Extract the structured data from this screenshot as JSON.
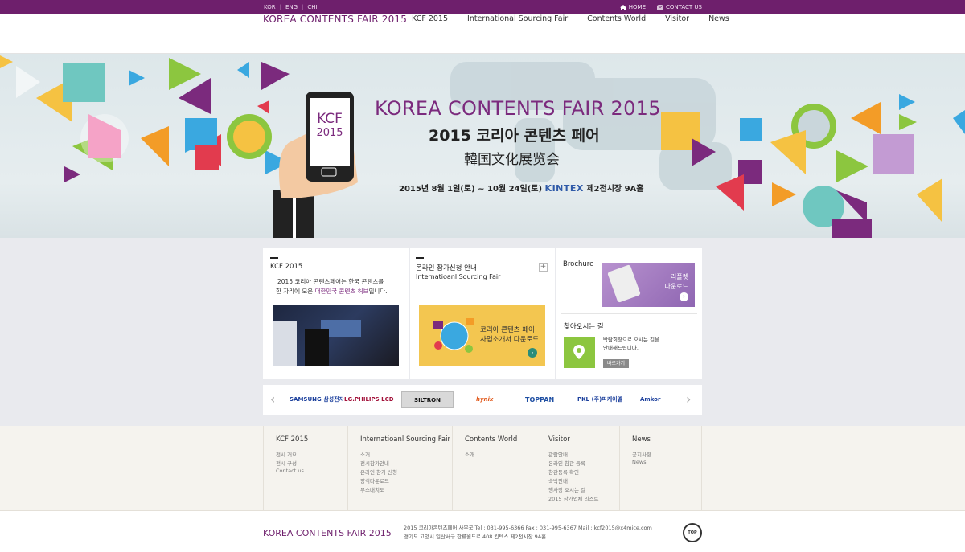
{
  "topbar": {
    "langs": [
      "KOR",
      "ENG",
      "CHI"
    ],
    "home": "HOME",
    "contact": "CONTACT US"
  },
  "header": {
    "logo": "KOREA CONTENTS FAIR 2015",
    "nav": [
      "KCF 2015",
      "International Sourcing Fair",
      "Contents World",
      "Visitor",
      "News"
    ]
  },
  "banner": {
    "title": "KOREA CONTENTS FAIR 2015",
    "title_ko": "2015 코리아 콘텐츠 페어",
    "title_cn": "韓国文化展览会",
    "phone_text": "KCF",
    "phone_year": "2015",
    "date": "2015년 8월 1일(토) ~ 10월 24일(토)",
    "venue_brand": "KINTEX",
    "venue": "제2전시장 9A홀"
  },
  "kcf_box": {
    "title": "KCF 2015",
    "line1": "2015 코리아 콘텐츠페어는 한국 콘텐츠를",
    "line2a": "한 자리에 모은 ",
    "line2b": "대한민국 콘텐츠 허브",
    "line2c": "입니다."
  },
  "sourcing_box": {
    "title1": "온라인 참가신청 안내",
    "title2": "Internatioanl Sourcing Fair",
    "banner_line1": "코리아 콘텐츠 페어",
    "banner_line2": "사업소개서 다운로드",
    "plus": "+"
  },
  "brochure_box": {
    "title": "Brochure",
    "leaflet1": "리플렛",
    "leaflet2": "다운로드",
    "map_title": "찾아오시는 길",
    "map_text1": "박람회장으로 오시는 길을",
    "map_text2": "안내해드립니다.",
    "map_btn": "바로가기"
  },
  "partners": [
    "SAMSUNG 삼성전자",
    "LG.PHILIPS LCD",
    "SILTRON",
    "hynix",
    "TOPPAN",
    "PKL (주)피케이엘",
    "Amkor"
  ],
  "footer_nav": [
    {
      "title": "KCF 2015",
      "items": [
        "전시 개요",
        "전시 구성",
        "Contact us"
      ]
    },
    {
      "title": "Internatioanl Sourcing Fair",
      "items": [
        "소개",
        "전시참가안내",
        "온라인 참가 신청",
        "양식다운로드",
        "부스배치도"
      ]
    },
    {
      "title": "Contents World",
      "items": [
        "소개"
      ]
    },
    {
      "title": "Visitor",
      "items": [
        "관람안내",
        "온라인 참관 등록",
        "참관등록 확인",
        "숙박안내",
        "행사장 오시는 길",
        "2015 참가업체 리스트"
      ]
    },
    {
      "title": "News",
      "items": [
        "공지사항",
        "News"
      ]
    }
  ],
  "bottom": {
    "logo": "KOREA CONTENTS FAIR 2015",
    "line1": "2015 코리아콘텐츠페어 사무국    Tel : 031-995-6366    Fax : 031-995-6367    Mail : kcf2015@x4mice.com",
    "line2": "경기도 고양시 일산서구 한류월드로 408 킨텍스 제2전시장 9A홀",
    "top": "TOP"
  },
  "colors": {
    "brand": "#6e1f6c",
    "accent_green": "#8cc63f",
    "accent_yellow": "#f5c242"
  }
}
